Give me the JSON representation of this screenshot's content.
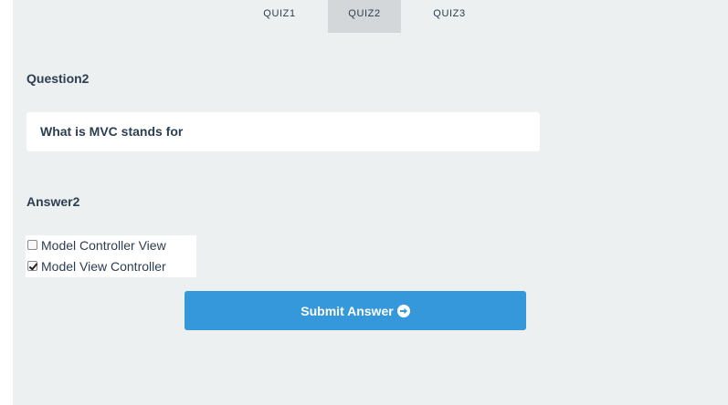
{
  "tabs": [
    {
      "label": "QUIZ1",
      "active": false
    },
    {
      "label": "QUIZ2",
      "active": true
    },
    {
      "label": "QUIZ3",
      "active": false
    }
  ],
  "question": {
    "heading": "Question2",
    "text": "What is MVC stands for"
  },
  "answer": {
    "heading": "Answer2",
    "options": [
      {
        "label": "Model Controller View",
        "checked": false
      },
      {
        "label": "Model View Controller",
        "checked": true
      }
    ]
  },
  "submit": {
    "label": "Submit Answer",
    "icon": "arrow-circle-right-icon"
  },
  "colors": {
    "background": "#ecf0f1",
    "accent": "#3498db",
    "text": "#2c3e50",
    "active_tab": "#d3d7d9"
  }
}
